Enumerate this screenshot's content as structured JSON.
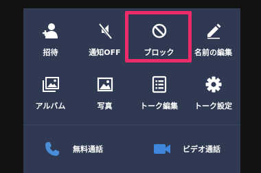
{
  "menu": {
    "items": [
      {
        "label": "招待",
        "icon": "add-friend-icon"
      },
      {
        "label": "通知OFF",
        "icon": "mute-icon"
      },
      {
        "label": "ブロック",
        "icon": "block-icon"
      },
      {
        "label": "名前の編集",
        "icon": "pencil-icon"
      },
      {
        "label": "アルバム",
        "icon": "album-icon"
      },
      {
        "label": "写真",
        "icon": "photo-icon"
      },
      {
        "label": "トーク編集",
        "icon": "list-icon"
      },
      {
        "label": "トーク設定",
        "icon": "gear-icon"
      }
    ],
    "calls": [
      {
        "label": "無料通話",
        "icon": "phone-icon"
      },
      {
        "label": "ビデオ通話",
        "icon": "video-camera-icon"
      }
    ]
  },
  "colors": {
    "panel": "#2f3a52",
    "phone_icon": "#4a8ed8",
    "video_icon": "#3f86dd",
    "highlight": "#ee2b6a"
  }
}
